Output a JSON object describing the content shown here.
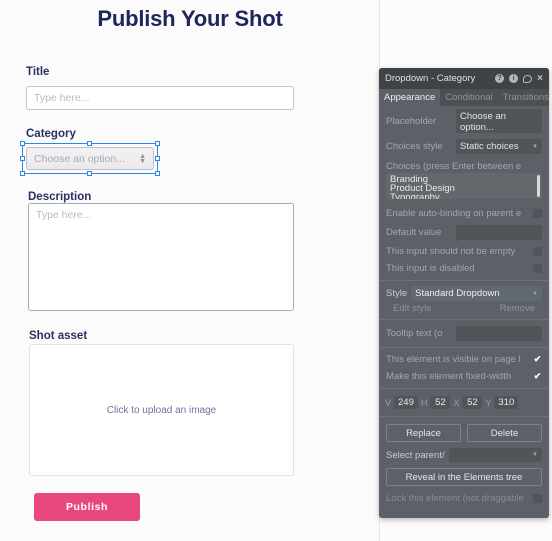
{
  "canvas": {
    "page_title": "Publish Your Shot",
    "fields": {
      "title": {
        "label": "Title",
        "placeholder": "Type here...",
        "value": ""
      },
      "category": {
        "label": "Category",
        "placeholder": "Choose an option...",
        "value": ""
      },
      "description": {
        "label": "Description",
        "placeholder": "Type here...",
        "value": ""
      },
      "shot_asset": {
        "label": "Shot asset",
        "upload_text": "Click to upload an image"
      }
    },
    "publish_button": "Publish",
    "accent_color": "#e8477f",
    "heading_color": "#20265c",
    "selection_color": "#2f86e8"
  },
  "inspector": {
    "header": {
      "title": "Dropdown - Category",
      "icons": [
        "help-circle-icon",
        "info-circle-icon",
        "comment-bubble-icon",
        "close-icon"
      ],
      "help_glyph": "?",
      "info_glyph": "i",
      "close_glyph": "×"
    },
    "tabs": [
      {
        "label": "Appearance",
        "active": true
      },
      {
        "label": "Conditional",
        "active": false
      },
      {
        "label": "Transitions",
        "active": false
      }
    ],
    "appearance": {
      "placeholder_label": "Placeholder",
      "placeholder_value": "Choose an option...",
      "choices_style_label": "Choices style",
      "choices_style_value": "Static choices",
      "choices_label": "Choices (press Enter between e",
      "choices_value": "Branding\nProduct Design\nTypography",
      "autobinding_label": "Enable auto-binding on parent e",
      "autobinding_checked": false,
      "default_value_label": "Default value",
      "default_value": "",
      "not_empty_label": "This input should not be empty",
      "not_empty_checked": false,
      "disabled_label": "This input is disabled",
      "disabled_checked": false,
      "style_label": "Style",
      "style_value": "Standard Dropdown",
      "edit_style_label": "Edit style",
      "remove_style_label": "Remove",
      "tooltip_label": "Tooltip text (o",
      "tooltip_value": "",
      "visible_label": "This element is visible on page l",
      "visible_checked": true,
      "fixed_width_label": "Make this element fixed-width",
      "fixed_width_checked": true,
      "check_glyph": "✔"
    },
    "dimensions": {
      "w_key": "V",
      "w_value": "249",
      "h_key": "H",
      "h_value": "52",
      "x_key": "X",
      "x_value": "52",
      "y_key": "Y",
      "y_value": "310"
    },
    "actions": {
      "replace_label": "Replace",
      "delete_label": "Delete",
      "select_parent_label": "Select parent/",
      "select_parent_value": "",
      "reveal_label": "Reveal in the Elements tree",
      "lock_label": "Lock this element (not draggable",
      "lock_checked": false
    }
  }
}
